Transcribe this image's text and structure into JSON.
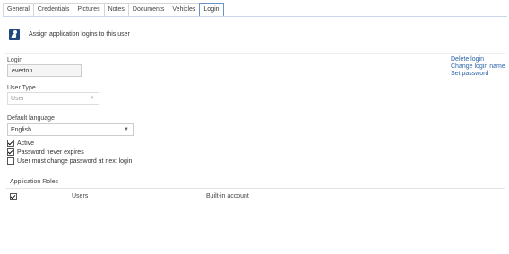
{
  "tabs": [
    "General",
    "Credentials",
    "Pictures",
    "Notes",
    "Documents",
    "Vehicles",
    "Login"
  ],
  "active_tab": "Login",
  "intro": "Assign application logins to this user",
  "login": {
    "label": "Login",
    "value": "everton"
  },
  "user_type": {
    "label": "User Type",
    "value": "User"
  },
  "default_language": {
    "label": "Default language",
    "value": "English"
  },
  "checkboxes": [
    {
      "label": "Active",
      "checked": true
    },
    {
      "label": "Password never expires",
      "checked": true
    },
    {
      "label": "User must change password at next login",
      "checked": false
    }
  ],
  "actions": [
    "Delete login",
    "Change login name",
    "Set password"
  ],
  "roles": {
    "title": "Application Roles",
    "rows": [
      {
        "checked": true,
        "name": "Users",
        "description": "Built-in account"
      }
    ]
  },
  "colors": {
    "accent": "#2a63a8",
    "icon": "#21477f"
  }
}
